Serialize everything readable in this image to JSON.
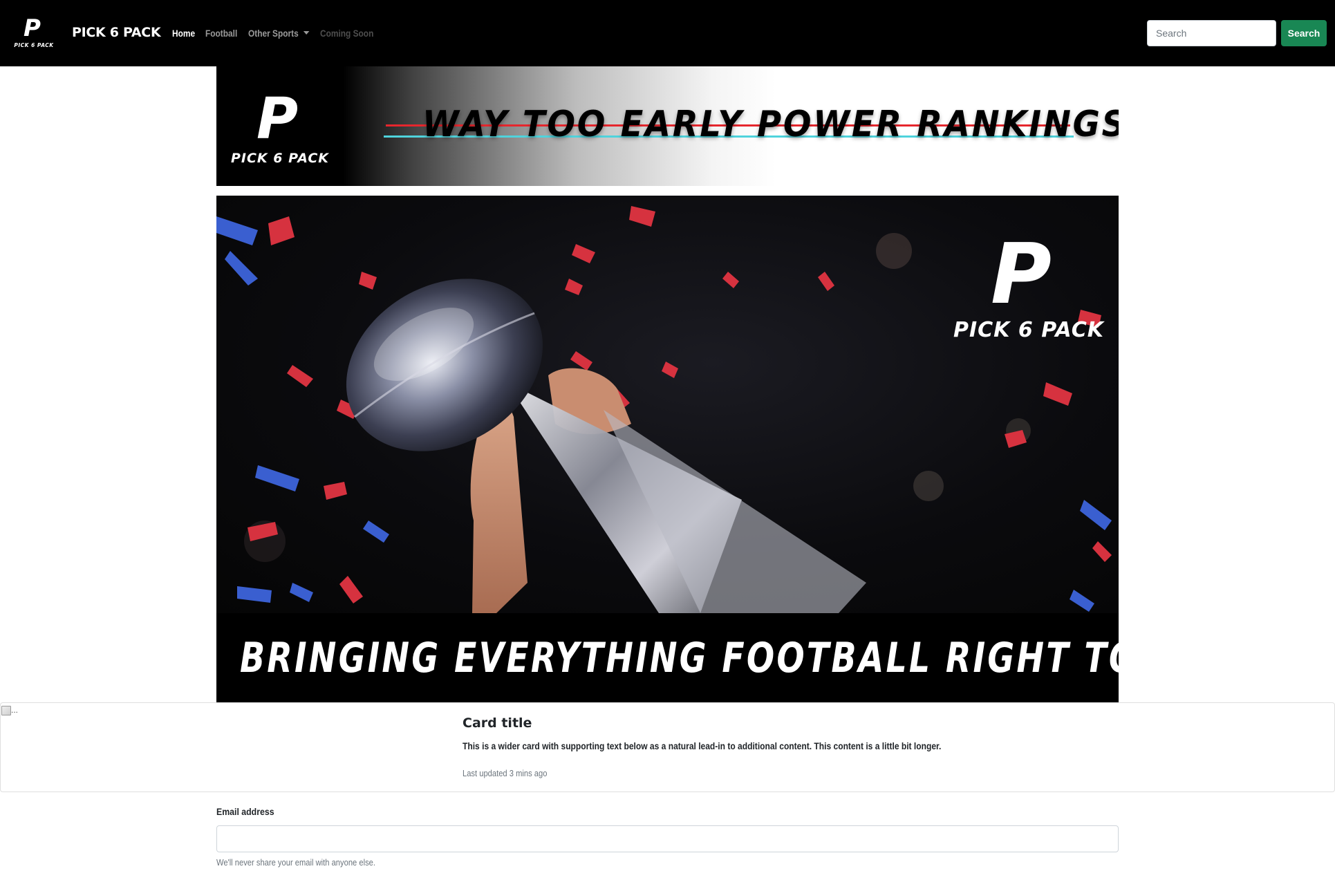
{
  "navbar": {
    "logo_letter": "P",
    "logo_text": "PICK 6 PACK",
    "brand": "PICK 6 PACK",
    "links": {
      "home": "Home",
      "football": "Football",
      "other_sports": "Other Sports",
      "coming_soon": "Coming Soon"
    },
    "search_placeholder": "Search",
    "search_button": "Search"
  },
  "banner": {
    "logo_letter": "P",
    "logo_text": "PICK 6 PACK",
    "title": "WAY TOO EARLY POWER RANKINGS"
  },
  "hero": {
    "logo_letter": "P",
    "logo_text": "PICK 6 PACK",
    "tagline": "BRINGING EVERYTHING FOOTBALL RIGHT TO YOU"
  },
  "card": {
    "image_alt": "...",
    "title": "Card title",
    "text": "This is a wider card with supporting text below as a natural lead-in to additional content. This content is a little bit longer.",
    "meta": "Last updated 3 mins ago"
  },
  "form": {
    "email_label": "Email address",
    "email_value": "",
    "email_help": "We'll never share your email with anyone else."
  },
  "colors": {
    "navbar_bg": "#000000",
    "search_button": "#198754",
    "banner_line_red": "#e6262d",
    "banner_line_cyan": "#4fd3dc",
    "confetti_red": "#d6323f",
    "confetti_blue": "#3a5fd0"
  }
}
